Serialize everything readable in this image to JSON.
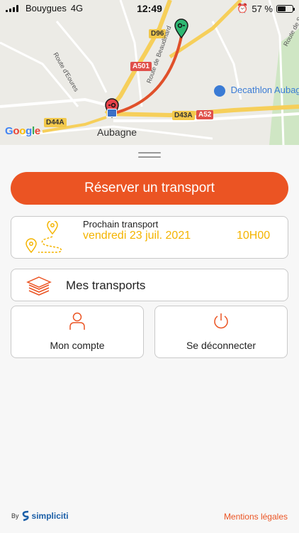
{
  "status_bar": {
    "carrier": "Bouygues",
    "network": "4G",
    "time": "12:49",
    "battery": "57 %",
    "battery_level": 0.57
  },
  "map": {
    "city": "Aubagne",
    "poi": "Decathlon Aubagne",
    "roads": [
      "D96",
      "A501",
      "D44A",
      "D43A",
      "A52"
    ],
    "street_labels": [
      "Route de Beaudinard",
      "Route d'Eoures",
      "Route de Saint-..."
    ],
    "attribution": "Google",
    "route_color": "#e0502a"
  },
  "actions": {
    "reserve_label": "Réserver un transport"
  },
  "next_transport": {
    "title": "Prochain transport",
    "date": "vendredi 23 juil. 2021",
    "time": "10H00"
  },
  "menu": {
    "my_transports": "Mes transports",
    "my_account": "Mon compte",
    "logout": "Se déconnecter"
  },
  "footer": {
    "by": "By",
    "brand": "simpliciti",
    "legal": "Mentions légales"
  },
  "colors": {
    "accent": "#eb5423",
    "highlight": "#f4b400"
  }
}
